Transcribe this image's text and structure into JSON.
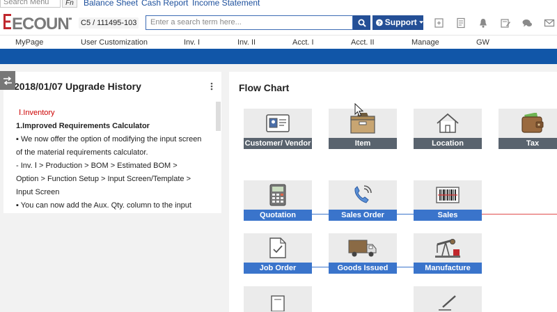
{
  "quickbar": {
    "search_placeholder": "Search Menu",
    "fn_label": "Fn",
    "links": [
      "Balance Sheet",
      "Cash Report",
      "Income Statement"
    ]
  },
  "header": {
    "logo_text": "ECOUNT",
    "company_code": "C5 / 111495-103",
    "search_placeholder": "Enter a search term here...",
    "support_label": "Support",
    "brand_color": "#244f96",
    "logo_color": "#c0272d"
  },
  "menu": {
    "items": [
      "MyPage",
      "User Customization",
      "Inv. I",
      "Inv. II",
      "Acct. I",
      "Acct. II",
      "Manage",
      "GW"
    ]
  },
  "upgrade_history": {
    "title": "2018/01/07 Upgrade History",
    "lines": [
      "Ⅰ.Inventory",
      "1.Improved Requirements Calculator",
      "▪ We now offer the option of modifying the input screen",
      "of the material requirements calculator.",
      "- Inv. Ⅰ > Production > BOM > Estimated BOM >",
      "Option > Function Setup > Input Screen/Template >",
      "Input Screen",
      "▪ You can now add the Aux. Qty. column to the input"
    ]
  },
  "flow_chart": {
    "title": "Flow Chart",
    "row1": [
      {
        "label": "Customer/ Vendor",
        "icon": "contact-card-icon"
      },
      {
        "label": "Item",
        "icon": "box-icon"
      },
      {
        "label": "Location",
        "icon": "house-icon"
      },
      {
        "label": "Tax",
        "icon": "wallet-icon"
      }
    ],
    "row2": [
      {
        "label": "Quotation",
        "icon": "calculator-icon"
      },
      {
        "label": "Sales Order",
        "icon": "phone-icon"
      },
      {
        "label": "Sales",
        "icon": "barcode-icon"
      }
    ],
    "row3": [
      {
        "label": "Job Order",
        "icon": "checklist-icon"
      },
      {
        "label": "Goods Issued",
        "icon": "truck-icon"
      },
      {
        "label": "Manufacture",
        "icon": "oil-pump-icon"
      }
    ],
    "colors": {
      "master_label": "#59636e",
      "flow_label": "#3a74cb",
      "sales_link": "#e04d4d"
    }
  }
}
